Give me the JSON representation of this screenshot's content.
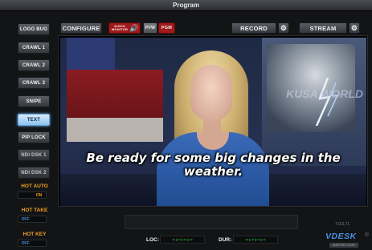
{
  "window": {
    "title": "Program"
  },
  "toolbar": {
    "configure": "CONFIGURE",
    "audio_monitor": "AUDIO MONITOR",
    "pvw": "PVW",
    "pgm": "PGM",
    "record": "RECORD",
    "stream": "STREAM",
    "gear_icon": "gear-icon",
    "speaker_icon": "speaker-icon"
  },
  "sidebar": {
    "items": [
      {
        "label": "LOGO BUG",
        "state": "normal"
      },
      {
        "label": "CRAWL 1",
        "state": "normal"
      },
      {
        "label": "CRAWL 2",
        "state": "normal"
      },
      {
        "label": "CRAWL 3",
        "state": "normal"
      },
      {
        "label": "SNIPE",
        "state": "normal"
      },
      {
        "label": "TEXT",
        "state": "active"
      },
      {
        "label": "PIP LOCK",
        "state": "normal"
      },
      {
        "label": "NDI DSK 1",
        "state": "dim"
      },
      {
        "label": "NDI DSK 2",
        "state": "dim"
      }
    ],
    "hot_auto": {
      "label": "HOT AUTO",
      "value": "ON"
    },
    "hot_take": {
      "label": "HOT TAKE",
      "value": "OFF"
    },
    "hot_key": {
      "label": "HOT KEY",
      "value": "OFF"
    }
  },
  "preview": {
    "caption": "Be ready for some big changes in the weather.",
    "background_text": "KUSA WORLD"
  },
  "status": {
    "loc_label": "LOC:",
    "loc_value": "—:—:—:—",
    "dur_label": "DUR:",
    "dur_value": "—:—:—:—"
  },
  "branding": {
    "version": "7.0.6.71",
    "logo": "VDESK",
    "logo_mark": "®",
    "badge": "MASTER LOOK"
  },
  "colors": {
    "accent_red": "#a11919",
    "active_blue": "#8cc2ef",
    "hot_orange": "#f0a020",
    "timecode_green": "#34d04a"
  }
}
